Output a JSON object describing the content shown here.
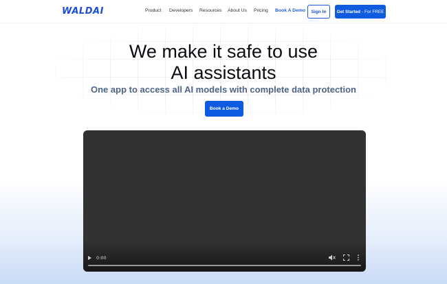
{
  "header": {
    "logo": "WALDAI",
    "nav": [
      {
        "label": "Product"
      },
      {
        "label": "Developers"
      },
      {
        "label": "Resources"
      },
      {
        "label": "About Us"
      },
      {
        "label": "Pricing"
      },
      {
        "label": "Book A Demo"
      }
    ],
    "sign_in": "Sign In",
    "get_started": "Get Started",
    "get_started_suffix": "- For FREE"
  },
  "hero": {
    "title_line1": "We make it safe to use",
    "title_line2": "AI assistants",
    "subtitle": "One app to access all AI models with complete data protection",
    "cta": "Book a Demo"
  },
  "video": {
    "time": "0:00",
    "controls": [
      "play-icon",
      "mute-icon",
      "fullscreen-icon",
      "more-options-icon"
    ]
  },
  "colors": {
    "accent": "#0f5be0",
    "subtitle": "#4d6486",
    "video_bg": "#323232"
  }
}
